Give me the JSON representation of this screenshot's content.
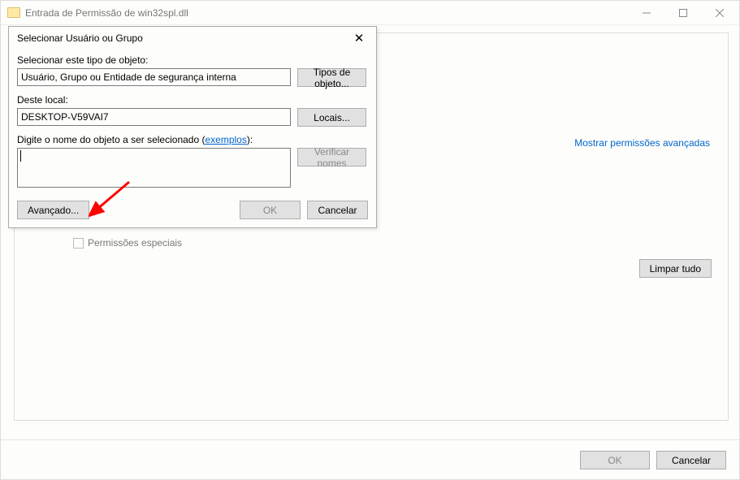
{
  "mainWindow": {
    "title": "Entrada de Permissão de win32spl.dll",
    "showAdvanced": "Mostrar permissões avançadas",
    "specialPermissions": "Permissões especiais",
    "clearAll": "Limpar tudo",
    "ok": "OK",
    "cancel": "Cancelar"
  },
  "dialog": {
    "title": "Selecionar Usuário ou Grupo",
    "objectTypeLabel": "Selecionar este tipo de objeto:",
    "objectTypeValue": "Usuário, Grupo ou Entidade de segurança interna",
    "objectTypeBtn": "Tipos de objeto...",
    "locationLabel": "Deste local:",
    "locationValue": "DESKTOP-V59VAI7",
    "locationBtn": "Locais...",
    "objectNameLabelPrefix": "Digite o nome do objeto a ser selecionado (",
    "examplesLink": "exemplos",
    "objectNameLabelSuffix": "):",
    "objectNameValue": "",
    "checkNamesBtn": "Verificar nomes",
    "advancedBtn": "Avançado...",
    "ok": "OK",
    "cancel": "Cancelar"
  }
}
